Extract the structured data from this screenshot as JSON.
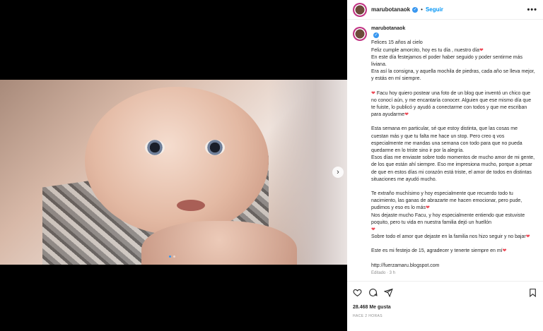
{
  "post": {
    "username": "marubotanaok",
    "follow_label": "Seguir",
    "more_label": "•••",
    "caption_lead": "Felices 15 años al cielo",
    "paragraphs": [
      "Feliz cumple amorcito, hoy es tu día , nuestro día",
      "En este día festejamos el poder haber seguido y poder sentirme más liviana.",
      "Era así la consigna, y aquella mochila de piedras, cada año se lleva mejor, y estás en mí siempre.",
      "Facu hoy quiero postear una foto de un blog que inventó un chico que no conocí aún, y me encantaría conocer. Alguien que ese mismo día que te fuiste, lo publicó y ayudó a conectarme con todos y que me escriban para ayudarme",
      "Esta semana en particular, sé que estoy distinta, que las cosas me cuestan más y que tu falta me hace un stop. Pero creo q vos especialmente me mandas una semana con todo para que no pueda quedarme en lo triste sino ir por la alegría.",
      "Esos días me enviaste sobre todo momentos de mucho amor de mi gente, de los que están ahí siempre. Eso me impresiona mucho, porque a pesar de que en estos días mi corazón está triste, el amor de todos en distintas situaciones me ayudó mucho.",
      "Te extraño muchísimo y hoy especialmente que recuerdo todo tu nacimiento, las ganas de abrazarte me hacen emocionar, pero pude, pudimos y eso es lo más",
      "Nos dejaste mucho Facu, y hoy especialmente entiendo que estuviste poquito, pero tu vida en nuestra familia dejó un huellón",
      "Sobre todo el amor que dejaste en la familia nos hizo seguir y no bajar",
      "Este es mi festejo de 15, agradecer y tenerte siempre en mí",
      "http://fuerzamaru.blogspot.com"
    ],
    "edited_label": "Editado · 3 h",
    "likes": "28.468 Me gusta",
    "posted_ago": "HACE 2 HORAS"
  },
  "icons": {
    "like": "heart-icon",
    "comment": "comment-icon",
    "share": "send-icon",
    "save": "bookmark-icon",
    "next": "chevron-right-icon"
  },
  "colors": {
    "link": "#0095f6",
    "heart": "#ed4956",
    "verified": "#3897f0"
  }
}
